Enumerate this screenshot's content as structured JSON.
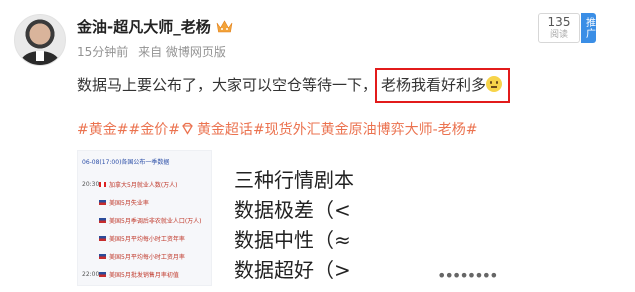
{
  "post": {
    "author_name": "金油-超凡大师_老杨",
    "meta": {
      "time": "15分钟前",
      "source": "来自 微博网页版"
    },
    "reads": {
      "count": "135",
      "label": "阅读"
    },
    "push_label": "推广",
    "text_main": "数据马上要公布了，大家可以空仓等待一下，",
    "text_highlight": "老杨我看好利多",
    "tags": [
      "#黄金#",
      "#金价#",
      "黄金超话",
      "#现货外汇黄金原油博弈大师-老杨#"
    ],
    "image_left": {
      "header": "06-08(17:00)各国公布一季数据",
      "rows": [
        {
          "time": "20:30",
          "flag": "ca",
          "text": "加拿大5月就业人数(万人)"
        },
        {
          "time": "",
          "flag": "us",
          "text": "美国5月失业率"
        },
        {
          "time": "",
          "flag": "us",
          "text": "美国5月季调后非农就业人口(万人)"
        },
        {
          "time": "",
          "flag": "us",
          "text": "美国5月平均每小时工资年率"
        },
        {
          "time": "",
          "flag": "us",
          "text": "美国5月平均每小时工资月率"
        },
        {
          "time": "22:00",
          "flag": "us",
          "text": "美国5月批发销售月率初值"
        }
      ]
    },
    "image_right": {
      "lines": [
        "三种行情剧本",
        "数据极差（<",
        "数据中性（≈",
        "数据超好（>"
      ]
    },
    "more": "••••••••"
  },
  "colors": {
    "accent": "#eb7350",
    "highlight_border": "#e21b1b",
    "push_bg": "#3a8ee6"
  }
}
